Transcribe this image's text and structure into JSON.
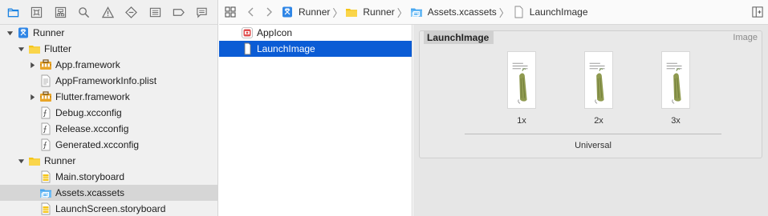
{
  "navigator": {
    "toolbar_icons": [
      "folder-icon",
      "source-control-icon",
      "hierarchy-icon",
      "find-icon",
      "issue-warning-icon",
      "test-diamond-icon",
      "debug-list-icon",
      "breakpoint-icon",
      "report-icon"
    ],
    "tree": [
      {
        "label": "Runner",
        "icon": "project-icon",
        "indent": 0,
        "disclosure": "open"
      },
      {
        "label": "Flutter",
        "icon": "group-folder-icon",
        "indent": 1,
        "disclosure": "open"
      },
      {
        "label": "App.framework",
        "icon": "framework-icon",
        "indent": 2,
        "disclosure": "closed"
      },
      {
        "label": "AppFrameworkInfo.plist",
        "icon": "plist-file-icon",
        "indent": 2,
        "disclosure": "none"
      },
      {
        "label": "Flutter.framework",
        "icon": "framework-icon",
        "indent": 2,
        "disclosure": "closed"
      },
      {
        "label": "Debug.xcconfig",
        "icon": "xcconfig-file-icon",
        "indent": 2,
        "disclosure": "none"
      },
      {
        "label": "Release.xcconfig",
        "icon": "xcconfig-file-icon",
        "indent": 2,
        "disclosure": "none"
      },
      {
        "label": "Generated.xcconfig",
        "icon": "xcconfig-file-icon",
        "indent": 2,
        "disclosure": "none"
      },
      {
        "label": "Runner",
        "icon": "group-folder-icon",
        "indent": 1,
        "disclosure": "open"
      },
      {
        "label": "Main.storyboard",
        "icon": "storyboard-file-icon",
        "indent": 2,
        "disclosure": "none"
      },
      {
        "label": "Assets.xcassets",
        "icon": "asset-catalog-icon",
        "indent": 2,
        "disclosure": "none",
        "selected": true
      },
      {
        "label": "LaunchScreen.storyboard",
        "icon": "storyboard-file-icon",
        "indent": 2,
        "disclosure": "none"
      }
    ]
  },
  "jumpbar": {
    "crumbs": [
      {
        "label": "Runner",
        "icon": "project-icon"
      },
      {
        "label": "Runner",
        "icon": "group-folder-icon"
      },
      {
        "label": "Assets.xcassets",
        "icon": "asset-catalog-icon"
      },
      {
        "label": "LaunchImage",
        "icon": "image-file-icon"
      }
    ]
  },
  "asset_list": {
    "items": [
      {
        "label": "AppIcon",
        "icon": "app-icon-set-icon",
        "selected": false
      },
      {
        "label": "LaunchImage",
        "icon": "image-set-icon",
        "selected": true
      }
    ]
  },
  "detail": {
    "name": "LaunchImage",
    "type": "Image",
    "slots": [
      {
        "label": "1x"
      },
      {
        "label": "2x"
      },
      {
        "label": "3x"
      }
    ],
    "group_label": "Universal"
  },
  "colors": {
    "selection_blue": "#0b5cd5",
    "folder_yellow": "#f5c518",
    "xcode_blue": "#1a82e2"
  }
}
